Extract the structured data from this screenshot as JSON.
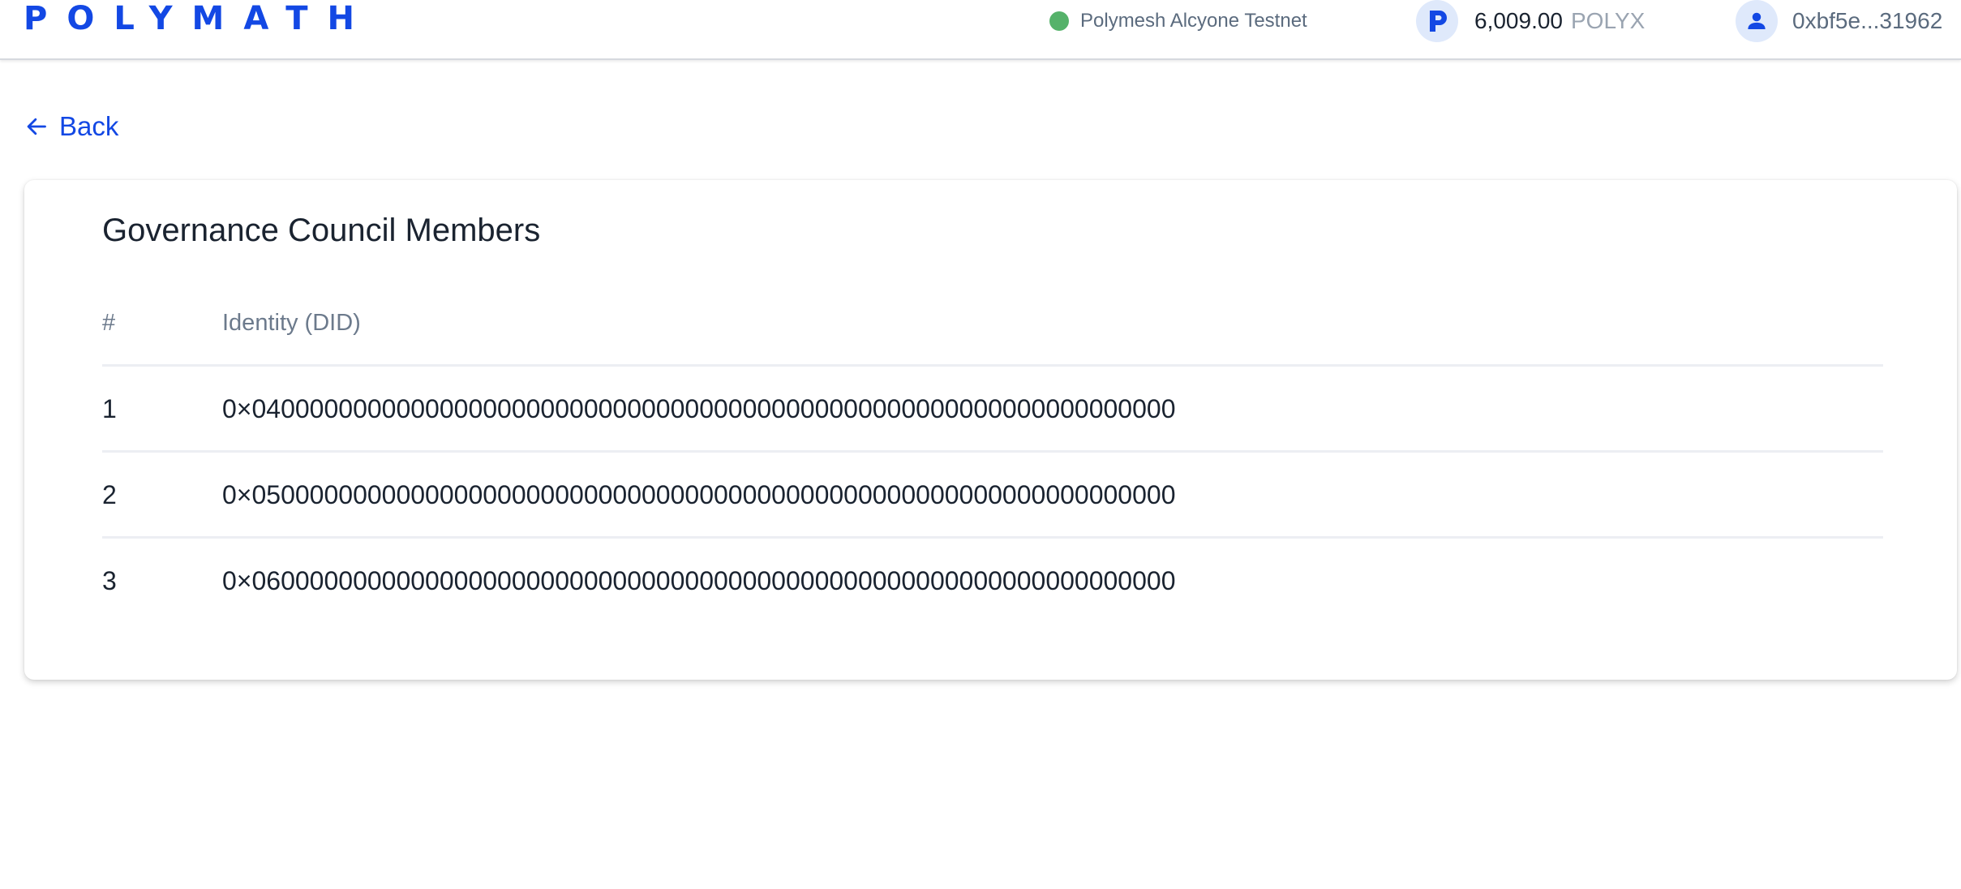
{
  "header": {
    "logo_text": "POLYMATH",
    "network": {
      "name": "Polymesh Alcyone Testnet",
      "status_color": "#55b26a"
    },
    "balance": {
      "icon": "polyx-token-icon",
      "amount": "6,009.00",
      "unit": "POLYX"
    },
    "account": {
      "icon": "user-icon",
      "address": "0xbf5e...31962"
    }
  },
  "back": {
    "icon": "arrow-left-icon",
    "label": "Back"
  },
  "card": {
    "title": "Governance Council Members",
    "table": {
      "columns": [
        "#",
        "Identity (DID)"
      ],
      "rows": [
        {
          "index": "1",
          "did": "0×0400000000000000000000000000000000000000000000000000000000000000"
        },
        {
          "index": "2",
          "did": "0×0500000000000000000000000000000000000000000000000000000000000000"
        },
        {
          "index": "3",
          "did": "0×0600000000000000000000000000000000000000000000000000000000000000"
        }
      ]
    }
  },
  "colors": {
    "brand": "#1348e4",
    "text": "#1a2330",
    "muted": "#6c7a8c",
    "icon_bg": "#dfe9fb"
  }
}
